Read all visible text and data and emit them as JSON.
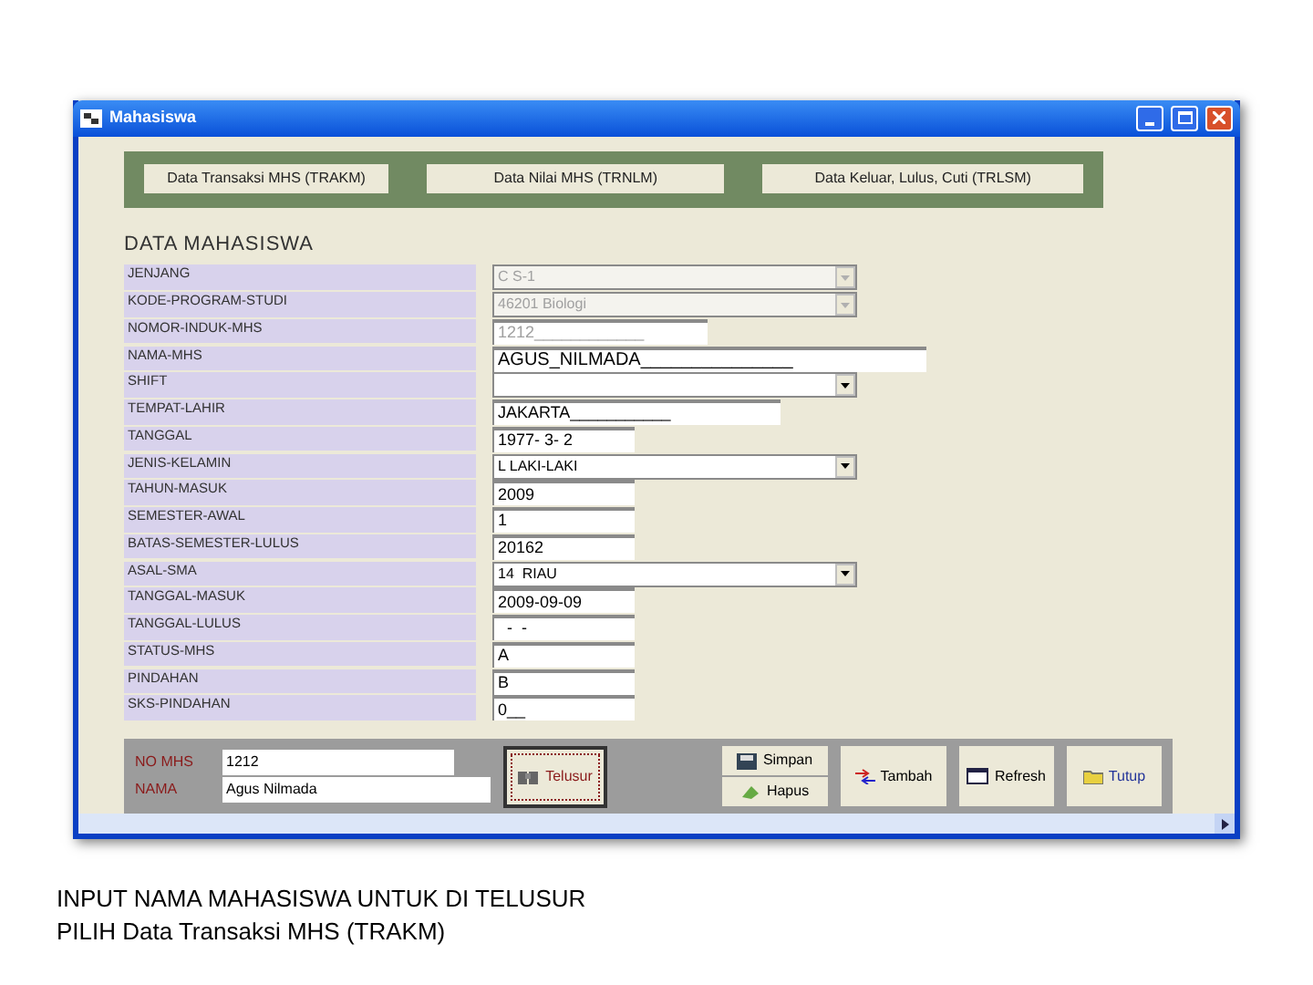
{
  "window": {
    "title": "Mahasiswa"
  },
  "top_buttons": [
    "Data Transaksi MHS (TRAKM)",
    "Data Nilai MHS (TRNLM)",
    "Data Keluar, Lulus, Cuti (TRLSM)"
  ],
  "section_title": "DATA MAHASISWA",
  "fields": [
    {
      "label": "JENJANG",
      "kind": "combo",
      "value": "C S-1",
      "disabled": true
    },
    {
      "label": "KODE-PROGRAM-STUDI",
      "kind": "combo",
      "value": "46201 Biologi",
      "disabled": true
    },
    {
      "label": "NOMOR-INDUK-MHS",
      "kind": "text",
      "value": "1212____________",
      "disabled": true
    },
    {
      "label": "NAMA-MHS",
      "kind": "text",
      "value": "AGUS_NILMADA_______________",
      "disabled": false
    },
    {
      "label": "SHIFT",
      "kind": "combo",
      "disabled": false
    },
    {
      "label": "TEMPAT-LAHIR",
      "kind": "text",
      "value": "JAKARTA___________",
      "disabled": false
    },
    {
      "label": "TANGGAL",
      "kind": "text",
      "value": "1977- 3- 2",
      "disabled": false
    },
    {
      "label": "JENIS-KELAMIN",
      "kind": "combo",
      "value": "L LAKI-LAKI",
      "disabled": false
    },
    {
      "label": "TAHUN-MASUK",
      "kind": "text",
      "value": "2009",
      "disabled": false
    },
    {
      "label": "SEMESTER-AWAL",
      "kind": "text",
      "value": "1",
      "disabled": false
    },
    {
      "label": "BATAS-SEMESTER-LULUS",
      "kind": "text",
      "value": "20162",
      "disabled": false
    },
    {
      "label": "ASAL-SMA",
      "kind": "combo",
      "value": "14  RIAU",
      "disabled": false
    },
    {
      "label": "TANGGAL-MASUK",
      "kind": "text",
      "value": "2009-09-09",
      "disabled": false
    },
    {
      "label": "TANGGAL-LULUS",
      "kind": "text",
      "value": "  -  -",
      "disabled": false
    },
    {
      "label": "STATUS-MHS",
      "kind": "text",
      "value": "A",
      "disabled": false
    },
    {
      "label": "PINDAHAN",
      "kind": "text",
      "value": "B",
      "disabled": false
    },
    {
      "label": "SKS-PINDAHAN",
      "kind": "text",
      "value": "0__",
      "disabled": false
    }
  ],
  "search": {
    "no_mhs_label": "NO MHS",
    "no_mhs_value": "1212",
    "nama_label": "NAMA",
    "nama_value": "Agus Nilmada",
    "search_button": "Telusur"
  },
  "actions": {
    "save": "Simpan",
    "delete": "Hapus",
    "add": "Tambah",
    "refresh": "Refresh",
    "close": "Tutup"
  },
  "caption": [
    "INPUT NAMA MAHASISWA UNTUK DI TELUSUR",
    "PILIH Data Transaksi MHS  (TRAKM)"
  ]
}
